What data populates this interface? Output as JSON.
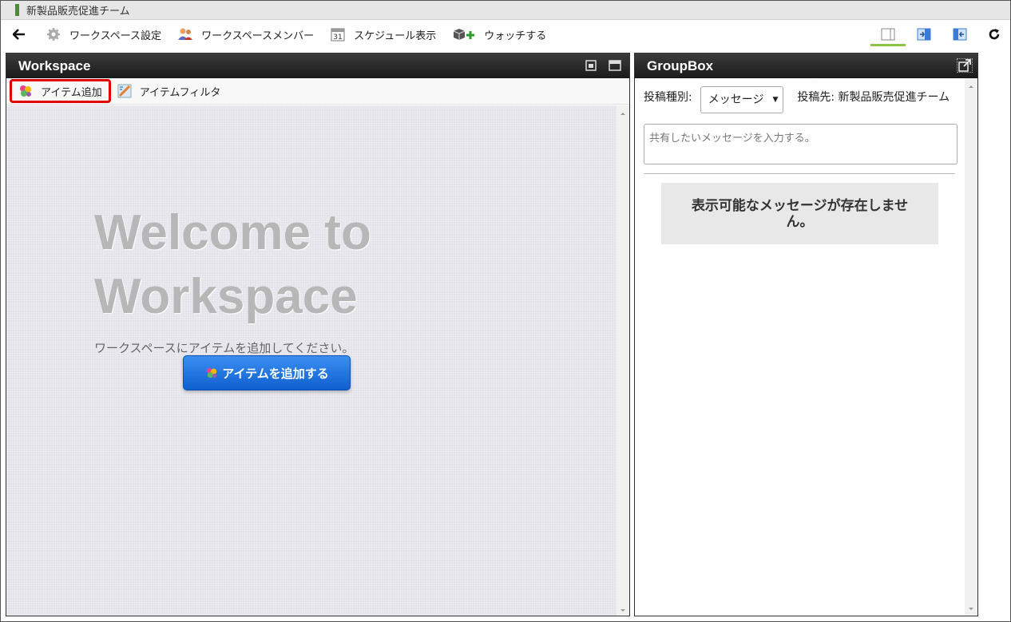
{
  "window": {
    "title": "新製品販売促進チーム"
  },
  "toolbar": {
    "items": [
      {
        "label": "ワークスペース設定",
        "icon": "gear-icon"
      },
      {
        "label": "ワークスペースメンバー",
        "icon": "members-icon"
      },
      {
        "label": "スケジュール表示",
        "icon": "calendar-icon"
      },
      {
        "label": "ウォッチする",
        "icon": "watch-add-icon"
      }
    ],
    "calendar_day": "31"
  },
  "workspace": {
    "title": "Workspace",
    "actions": {
      "add_item": "アイテム追加",
      "item_filter": "アイテムフィルタ"
    },
    "welcome_line1": "Welcome to",
    "welcome_line2": "Workspace",
    "subtitle": "ワークスペースにアイテムを追加してください。",
    "add_button": "アイテムを追加する"
  },
  "groupbox": {
    "title": "GroupBox",
    "post_type_label": "投稿種別:",
    "post_type_value": "メッセージ",
    "destination": "投稿先: 新製品販売促進チーム",
    "message_placeholder": "共有したいメッセージを入力する。",
    "empty_message": "表示可能なメッセージが存在しません。"
  },
  "colors": {
    "highlight": "#e00000",
    "primary_button": "#1a6fe0",
    "active_tab": "#8bc34a"
  }
}
